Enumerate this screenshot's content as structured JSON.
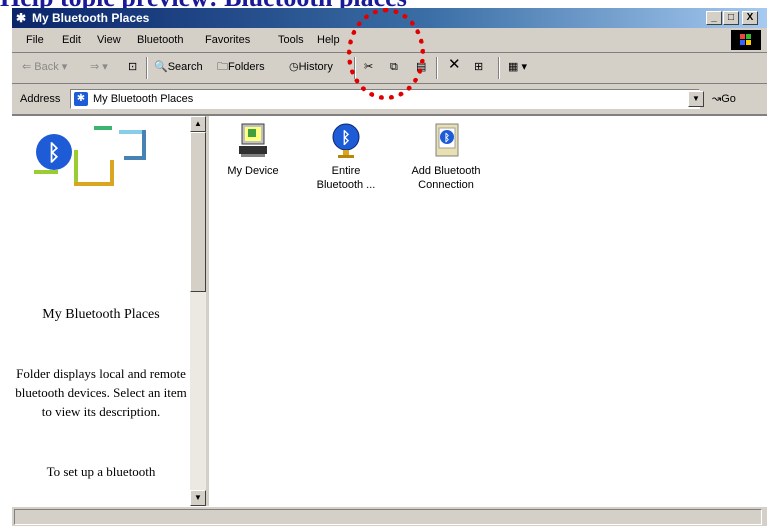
{
  "heading": "Help topic preview: Bluetooth places",
  "window": {
    "title": "My Bluetooth Places",
    "controls": {
      "minimize": "_",
      "maximize": "□",
      "close": "X"
    }
  },
  "menu": [
    "File",
    "Edit",
    "View",
    "Bluetooth",
    "Favorites",
    "Tools",
    "Help"
  ],
  "toolbar": {
    "back": "Back",
    "search": "Search",
    "folders": "Folders",
    "history": "History"
  },
  "address": {
    "label": "Address",
    "value": "My Bluetooth Places",
    "go": "Go"
  },
  "left_pane": {
    "title": "My Bluetooth Places",
    "description": "Folder displays local and remote bluetooth devices. Select an item to view its description.",
    "more": "To set up a bluetooth"
  },
  "items": [
    {
      "label_1": "My Device",
      "label_2": "",
      "icon": "computer-icon"
    },
    {
      "label_1": "Entire",
      "label_2": "Bluetooth ...",
      "icon": "bluetooth-globe-icon"
    },
    {
      "label_1": "Add Bluetooth",
      "label_2": "Connection",
      "icon": "add-bluetooth-icon"
    }
  ],
  "colors": {
    "titlebar_start": "#0a246a",
    "annotation": "#e00000",
    "bluetooth": "#1e5bd6"
  }
}
